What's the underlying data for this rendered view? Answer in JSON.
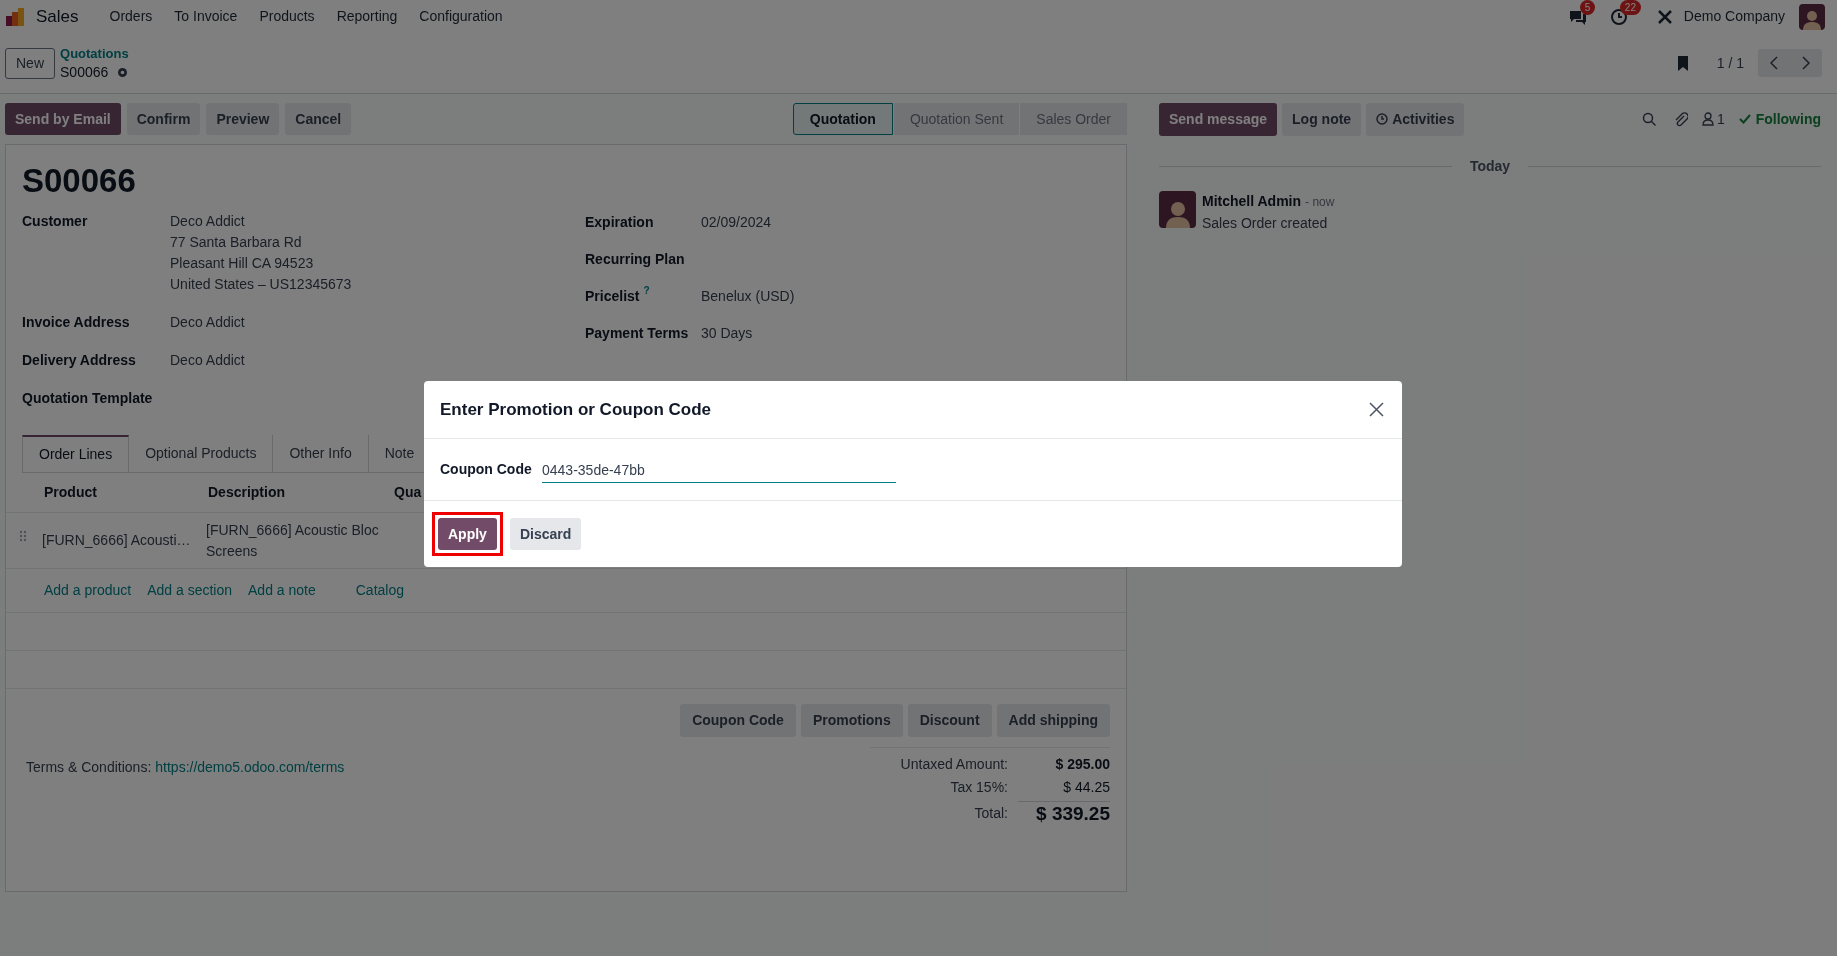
{
  "navbar": {
    "app": "Sales",
    "menu": [
      "Orders",
      "To Invoice",
      "Products",
      "Reporting",
      "Configuration"
    ],
    "messages_badge": "5",
    "activities_badge": "22",
    "company": "Demo Company"
  },
  "control_panel": {
    "new_button": "New",
    "breadcrumb": "Quotations",
    "record": "S00066",
    "pager": "1 / 1"
  },
  "actions": [
    {
      "label": "Send by Email",
      "primary": true
    },
    {
      "label": "Confirm",
      "primary": false
    },
    {
      "label": "Preview",
      "primary": false
    },
    {
      "label": "Cancel",
      "primary": false
    }
  ],
  "status_bar": [
    {
      "label": "Quotation",
      "selected": true
    },
    {
      "label": "Quotation Sent",
      "selected": false
    },
    {
      "label": "Sales Order",
      "selected": false
    }
  ],
  "form": {
    "title": "S00066",
    "left_fields": [
      {
        "label": "Customer",
        "lines": [
          "Deco Addict",
          "77 Santa Barbara Rd",
          "Pleasant Hill CA 94523",
          "United States – US12345673"
        ]
      },
      {
        "label": "Invoice Address",
        "lines": [
          "Deco Addict"
        ]
      },
      {
        "label": "Delivery Address",
        "lines": [
          "Deco Addict"
        ]
      },
      {
        "label": "Quotation Template"
      }
    ],
    "right_fields": [
      {
        "label": "Expiration",
        "value": "02/09/2024"
      },
      {
        "label": "Recurring Plan"
      },
      {
        "label": "Pricelist",
        "help": "?",
        "value": "Benelux (USD)"
      },
      {
        "label": "Payment Terms",
        "value": "30 Days"
      }
    ],
    "tabs": [
      {
        "label": "Order Lines",
        "selected": true
      },
      {
        "label": "Optional Products",
        "selected": false
      },
      {
        "label": "Other Info",
        "selected": false
      },
      {
        "label": "Note",
        "selected": false
      }
    ],
    "lines_table": {
      "columns": [
        "Product",
        "Description",
        "Qua"
      ],
      "rows": [
        {
          "cells": [
            "[FURN_6666] Acousti…",
            "[FURN_6666] Acoustic Bloc Screens"
          ]
        }
      ]
    },
    "add_links": [
      "Add a product",
      "Add a section",
      "Add a note",
      "Catalog"
    ],
    "reward_buttons": [
      "Coupon Code",
      "Promotions",
      "Discount",
      "Add shipping"
    ],
    "terms_label": "Terms & Conditions:",
    "terms_link": "https://demo5.odoo.com/terms",
    "totals": [
      {
        "label": "Untaxed Amount:",
        "value": "$ 295.00",
        "kind": "subtotal"
      },
      {
        "label": "Tax 15%:",
        "value": "$ 44.25",
        "kind": "tax"
      },
      {
        "label": "Total:",
        "value": "$ 339.25",
        "kind": "total"
      }
    ]
  },
  "chatter": {
    "buttons": [
      {
        "label": "Send message",
        "primary": true
      },
      {
        "label": "Log note",
        "primary": false
      },
      {
        "label": "Activities",
        "primary": false
      }
    ],
    "followers": "1",
    "following": "Following",
    "date_separator": "Today",
    "messages": [
      {
        "author": "Mitchell Admin",
        "time": "- now",
        "body": "Sales Order created"
      }
    ]
  },
  "dialog": {
    "title": "Enter Promotion or Coupon Code",
    "field_label": "Coupon Code",
    "field_value": "0443-35de-47bb",
    "buttons": [
      {
        "label": "Apply",
        "primary": true,
        "highlighted": true
      },
      {
        "label": "Discard",
        "primary": false,
        "highlighted": false
      }
    ]
  }
}
